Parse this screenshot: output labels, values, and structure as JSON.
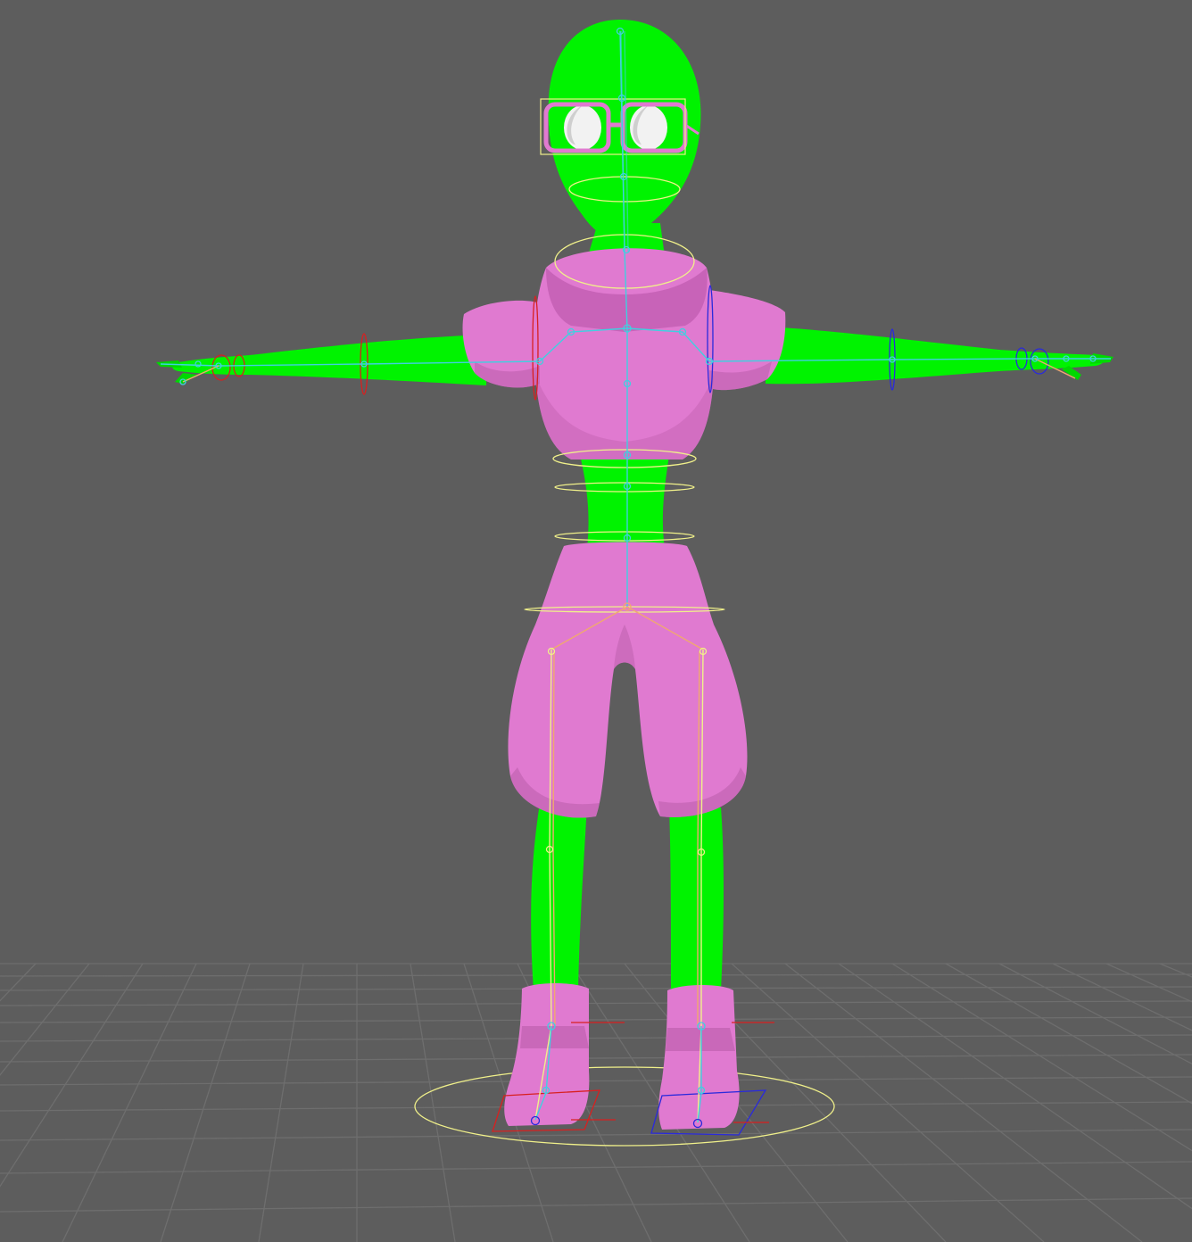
{
  "viewport": {
    "name": "3d-viewport",
    "background_color": "#5d5d5d",
    "grid_color": "#6e6e6e"
  },
  "character": {
    "pose": "T-pose",
    "skin_color": "#00f300",
    "clothing_color": "#e07ad0",
    "clothing_shadow_color": "#b65aa6",
    "eye_color": "#f2f2f2"
  },
  "rig": {
    "joint_color": "#40d0e0",
    "bone_color": "#f0a870",
    "control_color": "#f0f08a",
    "left_control_color": "#2a2adc",
    "right_control_color": "#d82020"
  }
}
